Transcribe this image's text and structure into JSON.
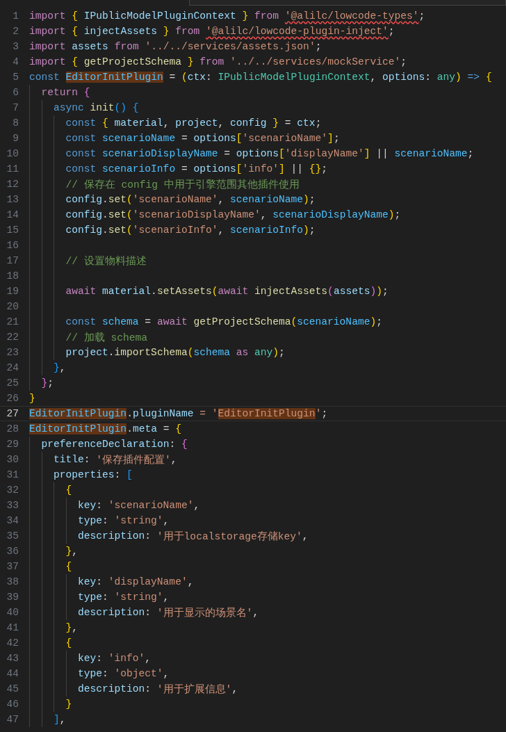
{
  "editor": {
    "lines": [
      {
        "number": "1",
        "current": false,
        "tokens": [
          {
            "text": "import ",
            "kind": "kw"
          },
          {
            "text": "{",
            "kind": "b1"
          },
          {
            "text": " IPublicModelPluginContext ",
            "kind": "var"
          },
          {
            "text": "}",
            "kind": "b1"
          },
          {
            "text": " from ",
            "kind": "kw"
          },
          {
            "text": "'@alilc/lowcode-types'",
            "kind": "str",
            "squiggle": true
          },
          {
            "text": ";",
            "kind": "p"
          }
        ]
      },
      {
        "number": "2",
        "current": false,
        "tokens": [
          {
            "text": "import ",
            "kind": "kw"
          },
          {
            "text": "{",
            "kind": "b1"
          },
          {
            "text": " injectAssets ",
            "kind": "var"
          },
          {
            "text": "}",
            "kind": "b1"
          },
          {
            "text": " from ",
            "kind": "kw"
          },
          {
            "text": "'@alilc/lowcode-plugin-inject'",
            "kind": "str",
            "squiggle": true
          },
          {
            "text": ";",
            "kind": "p"
          }
        ]
      },
      {
        "number": "3",
        "current": false,
        "tokens": [
          {
            "text": "import ",
            "kind": "kw"
          },
          {
            "text": "assets ",
            "kind": "var"
          },
          {
            "text": "from ",
            "kind": "kw"
          },
          {
            "text": "'../../services/assets.json'",
            "kind": "str"
          },
          {
            "text": ";",
            "kind": "p"
          }
        ]
      },
      {
        "number": "4",
        "current": false,
        "tokens": [
          {
            "text": "import ",
            "kind": "kw"
          },
          {
            "text": "{",
            "kind": "b1"
          },
          {
            "text": " getProjectSchema ",
            "kind": "fn"
          },
          {
            "text": "}",
            "kind": "b1"
          },
          {
            "text": " from ",
            "kind": "kw"
          },
          {
            "text": "'../../services/mockService'",
            "kind": "str"
          },
          {
            "text": ";",
            "kind": "p"
          }
        ]
      },
      {
        "number": "5",
        "current": false,
        "tokens": [
          {
            "text": "const ",
            "kind": "decl"
          },
          {
            "text": "EditorInitPlugin",
            "kind": "cst",
            "highlight": true
          },
          {
            "text": " = ",
            "kind": "p"
          },
          {
            "text": "(",
            "kind": "b1"
          },
          {
            "text": "ctx",
            "kind": "var"
          },
          {
            "text": ": ",
            "kind": "p"
          },
          {
            "text": "IPublicModelPluginContext",
            "kind": "type"
          },
          {
            "text": ", ",
            "kind": "p"
          },
          {
            "text": "options",
            "kind": "var"
          },
          {
            "text": ": ",
            "kind": "p"
          },
          {
            "text": "any",
            "kind": "type"
          },
          {
            "text": ")",
            "kind": "b1"
          },
          {
            "text": " =>",
            "kind": "decl"
          },
          {
            "text": " {",
            "kind": "b1"
          }
        ]
      },
      {
        "number": "6",
        "current": false,
        "tokens": [
          {
            "text": "  return ",
            "kind": "kw"
          },
          {
            "text": "{",
            "kind": "b2"
          }
        ]
      },
      {
        "number": "7",
        "current": false,
        "tokens": [
          {
            "text": "    async ",
            "kind": "decl"
          },
          {
            "text": "init",
            "kind": "fn"
          },
          {
            "text": "()",
            "kind": "b3"
          },
          {
            "text": " {",
            "kind": "b3"
          }
        ]
      },
      {
        "number": "8",
        "current": false,
        "tokens": [
          {
            "text": "      const ",
            "kind": "decl"
          },
          {
            "text": "{",
            "kind": "b1"
          },
          {
            "text": " material",
            "kind": "var"
          },
          {
            "text": ", ",
            "kind": "p"
          },
          {
            "text": "project",
            "kind": "var"
          },
          {
            "text": ", ",
            "kind": "p"
          },
          {
            "text": "config ",
            "kind": "var"
          },
          {
            "text": "}",
            "kind": "b1"
          },
          {
            "text": " = ",
            "kind": "p"
          },
          {
            "text": "ctx",
            "kind": "var"
          },
          {
            "text": ";",
            "kind": "p"
          }
        ]
      },
      {
        "number": "9",
        "current": false,
        "tokens": [
          {
            "text": "      const ",
            "kind": "decl"
          },
          {
            "text": "scenarioName",
            "kind": "cst"
          },
          {
            "text": " = ",
            "kind": "p"
          },
          {
            "text": "options",
            "kind": "var"
          },
          {
            "text": "[",
            "kind": "b1"
          },
          {
            "text": "'scenarioName'",
            "kind": "str"
          },
          {
            "text": "]",
            "kind": "b1"
          },
          {
            "text": ";",
            "kind": "p"
          }
        ]
      },
      {
        "number": "10",
        "current": false,
        "tokens": [
          {
            "text": "      const ",
            "kind": "decl"
          },
          {
            "text": "scenarioDisplayName",
            "kind": "cst"
          },
          {
            "text": " = ",
            "kind": "p"
          },
          {
            "text": "options",
            "kind": "var"
          },
          {
            "text": "[",
            "kind": "b1"
          },
          {
            "text": "'displayName'",
            "kind": "str"
          },
          {
            "text": "]",
            "kind": "b1"
          },
          {
            "text": " || ",
            "kind": "p"
          },
          {
            "text": "scenarioName",
            "kind": "cst"
          },
          {
            "text": ";",
            "kind": "p"
          }
        ]
      },
      {
        "number": "11",
        "current": false,
        "tokens": [
          {
            "text": "      const ",
            "kind": "decl"
          },
          {
            "text": "scenarioInfo",
            "kind": "cst"
          },
          {
            "text": " = ",
            "kind": "p"
          },
          {
            "text": "options",
            "kind": "var"
          },
          {
            "text": "[",
            "kind": "b1"
          },
          {
            "text": "'info'",
            "kind": "str"
          },
          {
            "text": "]",
            "kind": "b1"
          },
          {
            "text": " || ",
            "kind": "p"
          },
          {
            "text": "{}",
            "kind": "b1"
          },
          {
            "text": ";",
            "kind": "p"
          }
        ]
      },
      {
        "number": "12",
        "current": false,
        "tokens": [
          {
            "text": "      // 保存在 config 中用于引擎范围其他插件使用",
            "kind": "cm"
          }
        ]
      },
      {
        "number": "13",
        "current": false,
        "tokens": [
          {
            "text": "      config",
            "kind": "var"
          },
          {
            "text": ".",
            "kind": "p"
          },
          {
            "text": "set",
            "kind": "fn"
          },
          {
            "text": "(",
            "kind": "b1"
          },
          {
            "text": "'scenarioName'",
            "kind": "str"
          },
          {
            "text": ", ",
            "kind": "p"
          },
          {
            "text": "scenarioName",
            "kind": "cst"
          },
          {
            "text": ")",
            "kind": "b1"
          },
          {
            "text": ";",
            "kind": "p"
          }
        ]
      },
      {
        "number": "14",
        "current": false,
        "tokens": [
          {
            "text": "      config",
            "kind": "var"
          },
          {
            "text": ".",
            "kind": "p"
          },
          {
            "text": "set",
            "kind": "fn"
          },
          {
            "text": "(",
            "kind": "b1"
          },
          {
            "text": "'scenarioDisplayName'",
            "kind": "str"
          },
          {
            "text": ", ",
            "kind": "p"
          },
          {
            "text": "scenarioDisplayName",
            "kind": "cst"
          },
          {
            "text": ")",
            "kind": "b1"
          },
          {
            "text": ";",
            "kind": "p"
          }
        ]
      },
      {
        "number": "15",
        "current": false,
        "tokens": [
          {
            "text": "      config",
            "kind": "var"
          },
          {
            "text": ".",
            "kind": "p"
          },
          {
            "text": "set",
            "kind": "fn"
          },
          {
            "text": "(",
            "kind": "b1"
          },
          {
            "text": "'scenarioInfo'",
            "kind": "str"
          },
          {
            "text": ", ",
            "kind": "p"
          },
          {
            "text": "scenarioInfo",
            "kind": "cst"
          },
          {
            "text": ")",
            "kind": "b1"
          },
          {
            "text": ";",
            "kind": "p"
          }
        ]
      },
      {
        "number": "16",
        "current": false
      },
      {
        "number": "17",
        "current": false,
        "tokens": [
          {
            "text": "      // 设置物料描述",
            "kind": "cm"
          }
        ]
      },
      {
        "number": "18",
        "current": false
      },
      {
        "number": "19",
        "current": false,
        "tokens": [
          {
            "text": "      await ",
            "kind": "kw"
          },
          {
            "text": "material",
            "kind": "var"
          },
          {
            "text": ".",
            "kind": "p"
          },
          {
            "text": "setAssets",
            "kind": "fn"
          },
          {
            "text": "(",
            "kind": "b1"
          },
          {
            "text": "await ",
            "kind": "kw"
          },
          {
            "text": "injectAssets",
            "kind": "fn"
          },
          {
            "text": "(",
            "kind": "b2"
          },
          {
            "text": "assets",
            "kind": "var"
          },
          {
            "text": ")",
            "kind": "b2"
          },
          {
            "text": ")",
            "kind": "b1"
          },
          {
            "text": ";",
            "kind": "p"
          }
        ]
      },
      {
        "number": "20",
        "current": false
      },
      {
        "number": "21",
        "current": false,
        "tokens": [
          {
            "text": "      const ",
            "kind": "decl"
          },
          {
            "text": "schema",
            "kind": "cst"
          },
          {
            "text": " = ",
            "kind": "p"
          },
          {
            "text": "await ",
            "kind": "kw"
          },
          {
            "text": "getProjectSchema",
            "kind": "fn"
          },
          {
            "text": "(",
            "kind": "b1"
          },
          {
            "text": "scenarioName",
            "kind": "cst"
          },
          {
            "text": ")",
            "kind": "b1"
          },
          {
            "text": ";",
            "kind": "p"
          }
        ]
      },
      {
        "number": "22",
        "current": false,
        "tokens": [
          {
            "text": "      // 加载 schema",
            "kind": "cm"
          }
        ]
      },
      {
        "number": "23",
        "current": false,
        "tokens": [
          {
            "text": "      project",
            "kind": "var"
          },
          {
            "text": ".",
            "kind": "p"
          },
          {
            "text": "importSchema",
            "kind": "fn"
          },
          {
            "text": "(",
            "kind": "b1"
          },
          {
            "text": "schema",
            "kind": "cst"
          },
          {
            "text": " as ",
            "kind": "kw"
          },
          {
            "text": "any",
            "kind": "type"
          },
          {
            "text": ")",
            "kind": "b1"
          },
          {
            "text": ";",
            "kind": "p"
          }
        ]
      },
      {
        "number": "24",
        "current": false,
        "tokens": [
          {
            "text": "    }",
            "kind": "b3"
          },
          {
            "text": ",",
            "kind": "p"
          }
        ]
      },
      {
        "number": "25",
        "current": false,
        "tokens": [
          {
            "text": "  }",
            "kind": "b2"
          },
          {
            "text": ";",
            "kind": "p"
          }
        ]
      },
      {
        "number": "26",
        "current": false,
        "tokens": [
          {
            "text": "}",
            "kind": "b1"
          }
        ]
      },
      {
        "number": "27",
        "current": true,
        "tokens": [
          {
            "text": "EditorInitPlugin",
            "kind": "cst",
            "highlight": true
          },
          {
            "text": ".",
            "kind": "p"
          },
          {
            "text": "pluginName",
            "kind": "var"
          },
          {
            "text": " = '",
            "kind": "str"
          },
          {
            "text": "EditorInitPlugin",
            "kind": "str",
            "highlight": true
          },
          {
            "text": "'",
            "kind": "str"
          },
          {
            "text": ";",
            "kind": "p"
          }
        ]
      },
      {
        "number": "28",
        "current": false,
        "tokens": [
          {
            "text": "EditorInitPlugin",
            "kind": "cst",
            "highlight": true
          },
          {
            "text": ".",
            "kind": "p"
          },
          {
            "text": "meta",
            "kind": "var"
          },
          {
            "text": " = ",
            "kind": "p"
          },
          {
            "text": "{",
            "kind": "b1"
          }
        ]
      },
      {
        "number": "29",
        "current": false,
        "tokens": [
          {
            "text": "  preferenceDeclaration",
            "kind": "var"
          },
          {
            "text": ": ",
            "kind": "p"
          },
          {
            "text": "{",
            "kind": "b2"
          }
        ]
      },
      {
        "number": "30",
        "current": false,
        "tokens": [
          {
            "text": "    title",
            "kind": "var"
          },
          {
            "text": ": ",
            "kind": "p"
          },
          {
            "text": "'保存插件配置'",
            "kind": "str"
          },
          {
            "text": ",",
            "kind": "p"
          }
        ]
      },
      {
        "number": "31",
        "current": false,
        "tokens": [
          {
            "text": "    properties",
            "kind": "var"
          },
          {
            "text": ": ",
            "kind": "p"
          },
          {
            "text": "[",
            "kind": "b3"
          }
        ]
      },
      {
        "number": "32",
        "current": false,
        "tokens": [
          {
            "text": "      {",
            "kind": "b1"
          }
        ]
      },
      {
        "number": "33",
        "current": false,
        "tokens": [
          {
            "text": "        key",
            "kind": "var"
          },
          {
            "text": ": ",
            "kind": "p"
          },
          {
            "text": "'scenarioName'",
            "kind": "str"
          },
          {
            "text": ",",
            "kind": "p"
          }
        ]
      },
      {
        "number": "34",
        "current": false,
        "tokens": [
          {
            "text": "        type",
            "kind": "var"
          },
          {
            "text": ": ",
            "kind": "p"
          },
          {
            "text": "'string'",
            "kind": "str"
          },
          {
            "text": ",",
            "kind": "p"
          }
        ]
      },
      {
        "number": "35",
        "current": false,
        "tokens": [
          {
            "text": "        description",
            "kind": "var"
          },
          {
            "text": ": ",
            "kind": "p"
          },
          {
            "text": "'用于localstorage存储key'",
            "kind": "str"
          },
          {
            "text": ",",
            "kind": "p"
          }
        ]
      },
      {
        "number": "36",
        "current": false,
        "tokens": [
          {
            "text": "      }",
            "kind": "b1"
          },
          {
            "text": ",",
            "kind": "p"
          }
        ]
      },
      {
        "number": "37",
        "current": false,
        "tokens": [
          {
            "text": "      {",
            "kind": "b1"
          }
        ]
      },
      {
        "number": "38",
        "current": false,
        "tokens": [
          {
            "text": "        key",
            "kind": "var"
          },
          {
            "text": ": ",
            "kind": "p"
          },
          {
            "text": "'displayName'",
            "kind": "str"
          },
          {
            "text": ",",
            "kind": "p"
          }
        ]
      },
      {
        "number": "39",
        "current": false,
        "tokens": [
          {
            "text": "        type",
            "kind": "var"
          },
          {
            "text": ": ",
            "kind": "p"
          },
          {
            "text": "'string'",
            "kind": "str"
          },
          {
            "text": ",",
            "kind": "p"
          }
        ]
      },
      {
        "number": "40",
        "current": false,
        "tokens": [
          {
            "text": "        description",
            "kind": "var"
          },
          {
            "text": ": ",
            "kind": "p"
          },
          {
            "text": "'用于显示的场景名'",
            "kind": "str"
          },
          {
            "text": ",",
            "kind": "p"
          }
        ]
      },
      {
        "number": "41",
        "current": false,
        "tokens": [
          {
            "text": "      }",
            "kind": "b1"
          },
          {
            "text": ",",
            "kind": "p"
          }
        ]
      },
      {
        "number": "42",
        "current": false,
        "tokens": [
          {
            "text": "      {",
            "kind": "b1"
          }
        ]
      },
      {
        "number": "43",
        "current": false,
        "tokens": [
          {
            "text": "        key",
            "kind": "var"
          },
          {
            "text": ": ",
            "kind": "p"
          },
          {
            "text": "'info'",
            "kind": "str"
          },
          {
            "text": ",",
            "kind": "p"
          }
        ]
      },
      {
        "number": "44",
        "current": false,
        "tokens": [
          {
            "text": "        type",
            "kind": "var"
          },
          {
            "text": ": ",
            "kind": "p"
          },
          {
            "text": "'object'",
            "kind": "str"
          },
          {
            "text": ",",
            "kind": "p"
          }
        ]
      },
      {
        "number": "45",
        "current": false,
        "tokens": [
          {
            "text": "        description",
            "kind": "var"
          },
          {
            "text": ": ",
            "kind": "p"
          },
          {
            "text": "'用于扩展信息'",
            "kind": "str"
          },
          {
            "text": ",",
            "kind": "p"
          }
        ]
      },
      {
        "number": "46",
        "current": false,
        "tokens": [
          {
            "text": "      }",
            "kind": "b1"
          }
        ]
      },
      {
        "number": "47",
        "current": false,
        "tokens": [
          {
            "text": "    ]",
            "kind": "b3"
          },
          {
            "text": ",",
            "kind": "p"
          }
        ]
      }
    ]
  }
}
